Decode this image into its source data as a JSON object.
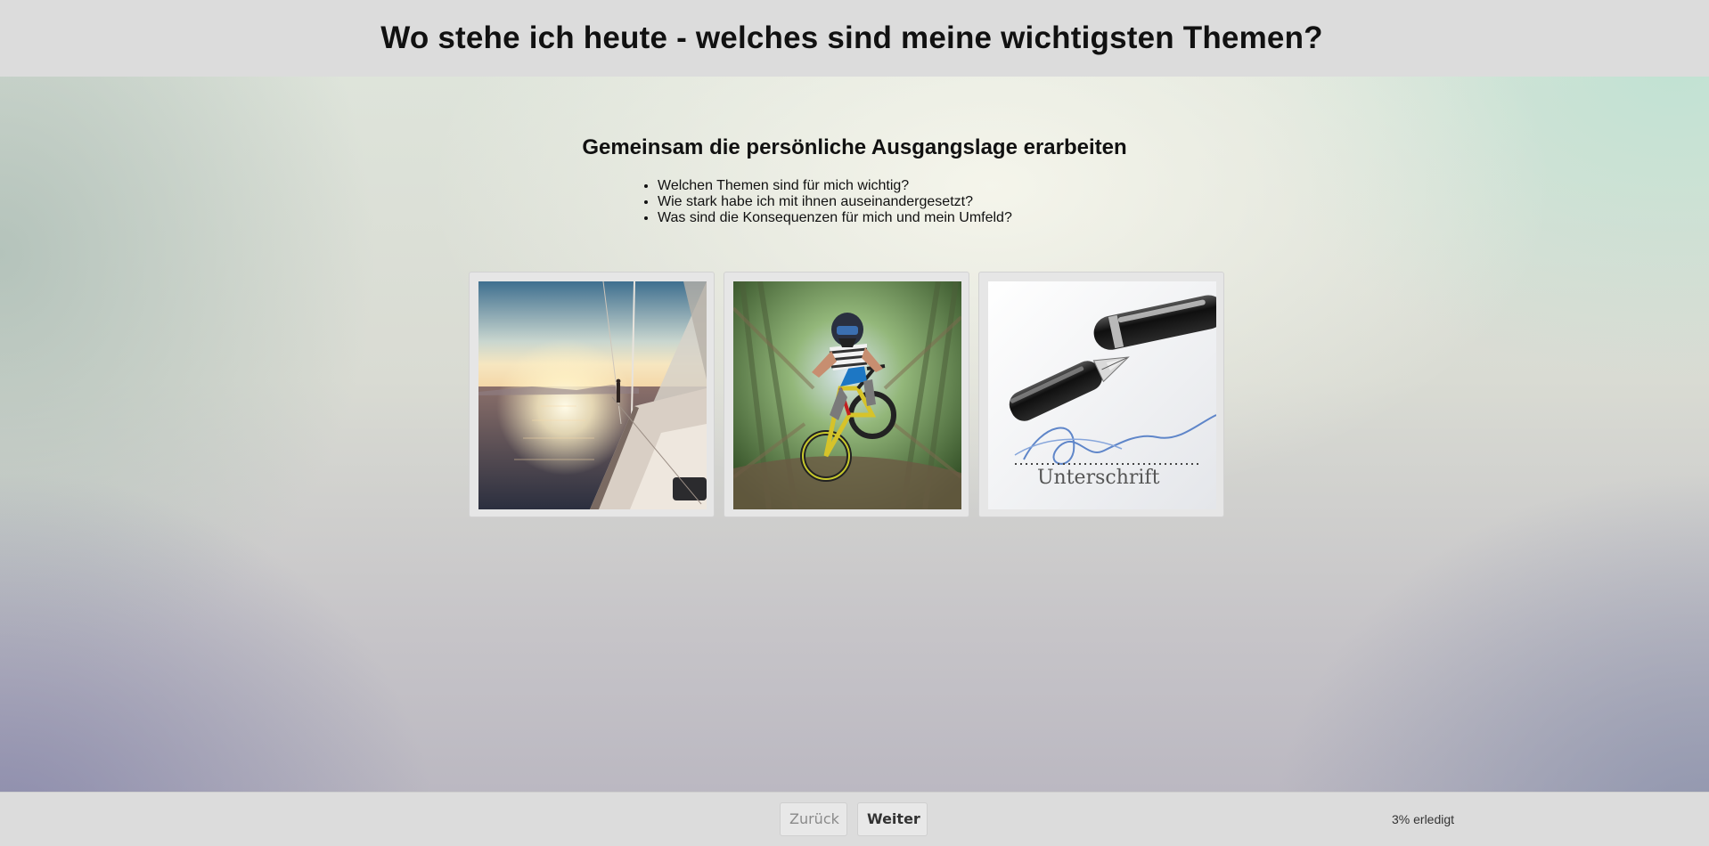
{
  "header": {
    "title": "Wo stehe ich heute - welches sind meine wichtigsten Themen?"
  },
  "main": {
    "subtitle": "Gemeinsam die persönliche Ausgangslage erarbeiten",
    "bullets": [
      "Welchen Themen sind für mich wichtig?",
      "Wie stark habe ich mit ihnen auseinandergesetzt?",
      "Was sind die Konsequenzen für mich und mein Umfeld?"
    ],
    "images": [
      {
        "name": "sailboat-sunset-image"
      },
      {
        "name": "mountain-biker-image"
      },
      {
        "name": "fountain-pen-signature-image",
        "caption": "Unterschrift"
      }
    ]
  },
  "footer": {
    "back_label": "Zurück",
    "next_label": "Weiter",
    "progress_text": "3% erledigt"
  }
}
